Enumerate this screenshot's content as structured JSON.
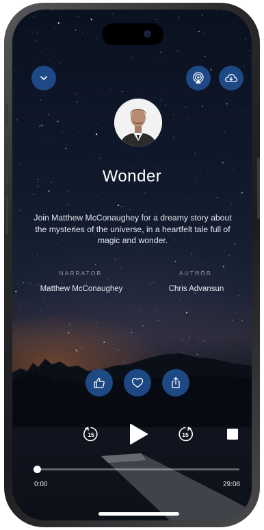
{
  "header": {
    "collapse_icon": "chevron-down-icon",
    "airplay_icon": "airplay-audio-icon",
    "download_icon": "cloud-download-icon"
  },
  "story": {
    "title": "Wonder",
    "description": "Join Matthew McConaughey for a dreamy story about the mysteries of the universe, in a heartfelt tale full of magic and wonder.",
    "narrator_label": "NARRATOR",
    "narrator": "Matthew McConaughey",
    "author_label": "AUTHOR",
    "author": "Chris Advansun"
  },
  "actions": {
    "like_icon": "thumbs-up-icon",
    "favorite_icon": "heart-icon",
    "share_icon": "share-icon"
  },
  "player": {
    "rewind_seconds": "15",
    "forward_seconds": "15",
    "current_time": "0:00",
    "total_time": "29:08",
    "progress": 0.0
  },
  "colors": {
    "button_blue": "#204e8e",
    "text": "#e6e9f0",
    "label": "#8e95a3"
  }
}
